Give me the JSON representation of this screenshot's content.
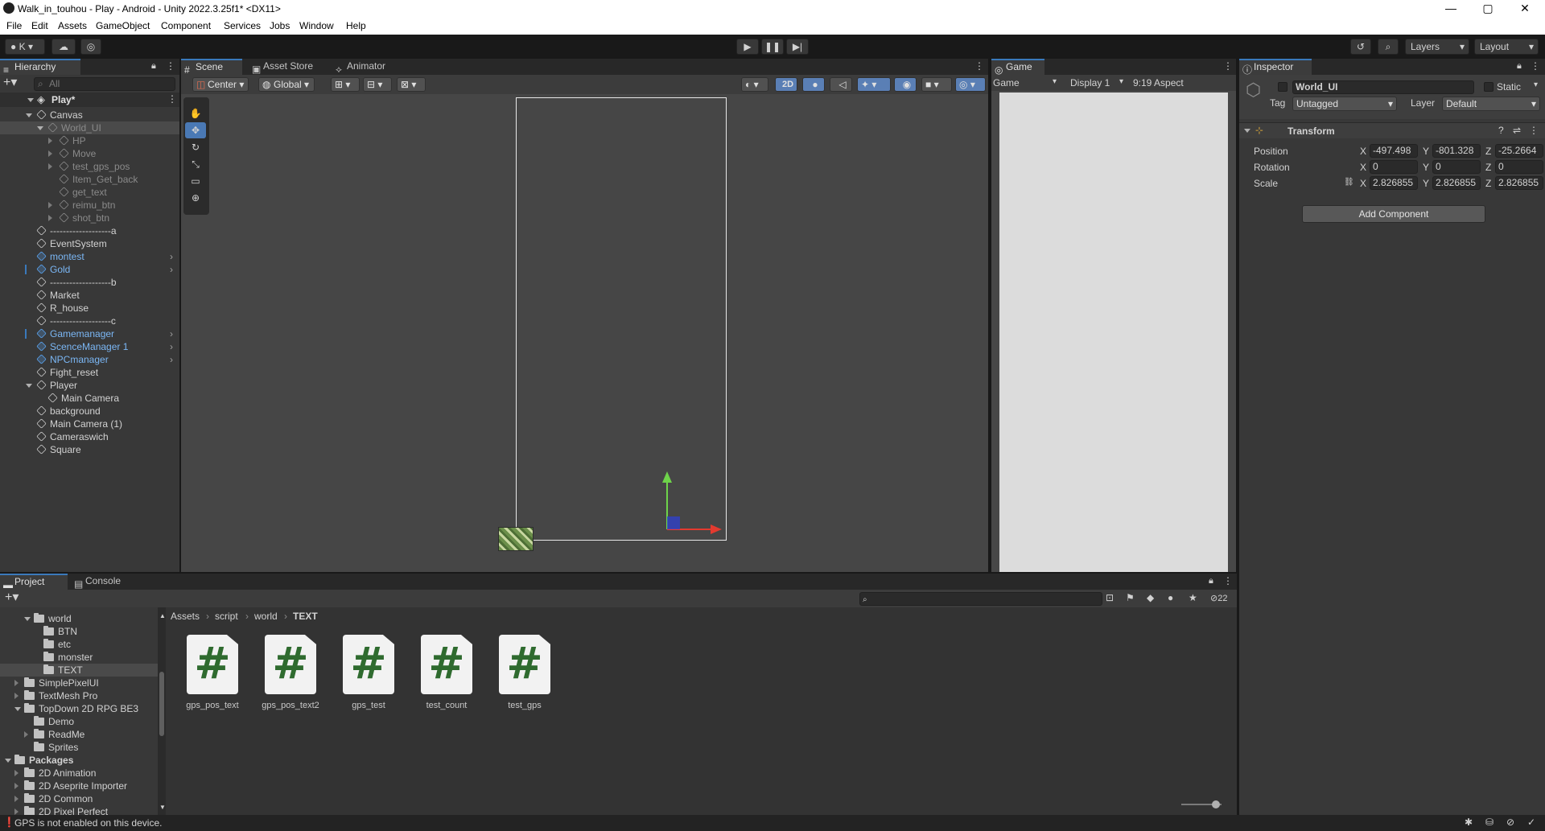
{
  "window": {
    "title": "Walk_in_touhou - Play - Android - Unity 2022.3.25f1* <DX11>",
    "controls": [
      "—",
      "▢",
      "✕"
    ]
  },
  "menu": [
    "File",
    "Edit",
    "Assets",
    "GameObject",
    "Component",
    "Services",
    "Jobs",
    "Window",
    "Help"
  ],
  "toolbar": {
    "account": "K",
    "layers": "Layers",
    "layout": "Layout"
  },
  "hierarchy": {
    "tab": "Hierarchy",
    "search_placeholder": "All",
    "scene": "Play*",
    "items": [
      {
        "label": "Canvas",
        "indent": 1,
        "arrow": "down",
        "style": "normal"
      },
      {
        "label": "World_UI",
        "indent": 2,
        "arrow": "down",
        "style": "dim"
      },
      {
        "label": "HP",
        "indent": 3,
        "arrow": "right",
        "style": "dim"
      },
      {
        "label": "Move",
        "indent": 3,
        "arrow": "right",
        "style": "dim"
      },
      {
        "label": "test_gps_pos",
        "indent": 3,
        "arrow": "right",
        "style": "dim"
      },
      {
        "label": "Item_Get_back",
        "indent": 3,
        "arrow": "",
        "style": "dim"
      },
      {
        "label": "get_text",
        "indent": 3,
        "arrow": "",
        "style": "dim"
      },
      {
        "label": "reimu_btn",
        "indent": 3,
        "arrow": "right",
        "style": "dim"
      },
      {
        "label": "shot_btn",
        "indent": 3,
        "arrow": "right",
        "style": "dim"
      },
      {
        "label": "-------------------a",
        "indent": 1,
        "arrow": "",
        "style": "normal"
      },
      {
        "label": "EventSystem",
        "indent": 1,
        "arrow": "",
        "style": "normal"
      },
      {
        "label": "montest",
        "indent": 1,
        "arrow": "",
        "style": "blue",
        "chevron": true
      },
      {
        "label": "Gold",
        "indent": 1,
        "arrow": "",
        "style": "blue",
        "chevron": true
      },
      {
        "label": "-------------------b",
        "indent": 1,
        "arrow": "",
        "style": "normal"
      },
      {
        "label": "Market",
        "indent": 1,
        "arrow": "",
        "style": "normal"
      },
      {
        "label": "R_house",
        "indent": 1,
        "arrow": "",
        "style": "normal"
      },
      {
        "label": "-------------------c",
        "indent": 1,
        "arrow": "",
        "style": "normal"
      },
      {
        "label": "Gamemanager",
        "indent": 1,
        "arrow": "",
        "style": "blue",
        "chevron": true
      },
      {
        "label": "ScenceManager 1",
        "indent": 1,
        "arrow": "",
        "style": "blue",
        "chevron": true
      },
      {
        "label": "NPCmanager",
        "indent": 1,
        "arrow": "",
        "style": "blue",
        "chevron": true
      },
      {
        "label": "Fight_reset",
        "indent": 1,
        "arrow": "",
        "style": "normal"
      },
      {
        "label": "Player",
        "indent": 1,
        "arrow": "down",
        "style": "normal"
      },
      {
        "label": "Main Camera",
        "indent": 2,
        "arrow": "",
        "style": "normal"
      },
      {
        "label": "background",
        "indent": 1,
        "arrow": "",
        "style": "normal"
      },
      {
        "label": "Main Camera (1)",
        "indent": 1,
        "arrow": "",
        "style": "normal"
      },
      {
        "label": "Cameraswich",
        "indent": 1,
        "arrow": "",
        "style": "normal"
      },
      {
        "label": "Square",
        "indent": 1,
        "arrow": "",
        "style": "normal"
      }
    ]
  },
  "scene_tabs": [
    "Scene",
    "Asset Store",
    "Animator"
  ],
  "scene_toolbar": {
    "pivot": "Center",
    "space": "Global",
    "mode_2d": "2D"
  },
  "game": {
    "tab": "Game",
    "view": "Game",
    "display": "Display 1",
    "aspect": "9:19 Aspect"
  },
  "inspector": {
    "tab": "Inspector",
    "object_name": "World_UI",
    "static_label": "Static",
    "tag_label": "Tag",
    "tag_value": "Untagged",
    "layer_label": "Layer",
    "layer_value": "Default",
    "component": "Transform",
    "rows": [
      {
        "label": "Position",
        "x": "-497.498",
        "y": "-801.328",
        "z": "-25.2664"
      },
      {
        "label": "Rotation",
        "x": "0",
        "y": "0",
        "z": "0"
      },
      {
        "label": "Scale",
        "x": "2.826855",
        "y": "2.826855",
        "z": "2.826855"
      }
    ],
    "add_component": "Add Component"
  },
  "project": {
    "tabs": [
      "Project",
      "Console"
    ],
    "hidden_count": "22",
    "tree": [
      {
        "label": "world",
        "indent": 2,
        "arrow": "down",
        "bold": false
      },
      {
        "label": "BTN",
        "indent": 3,
        "arrow": "",
        "bold": false
      },
      {
        "label": "etc",
        "indent": 3,
        "arrow": "",
        "bold": false
      },
      {
        "label": "monster",
        "indent": 3,
        "arrow": "",
        "bold": false
      },
      {
        "label": "TEXT",
        "indent": 3,
        "arrow": "",
        "bold": false,
        "selected": true
      },
      {
        "label": "SimplePixelUI",
        "indent": 1,
        "arrow": "right",
        "bold": false
      },
      {
        "label": "TextMesh Pro",
        "indent": 1,
        "arrow": "right",
        "bold": false
      },
      {
        "label": "TopDown 2D RPG BE3",
        "indent": 1,
        "arrow": "down",
        "bold": false
      },
      {
        "label": "Demo",
        "indent": 2,
        "arrow": "",
        "bold": false
      },
      {
        "label": "ReadMe",
        "indent": 2,
        "arrow": "right",
        "bold": false
      },
      {
        "label": "Sprites",
        "indent": 2,
        "arrow": "",
        "bold": false
      },
      {
        "label": "Packages",
        "indent": 0,
        "arrow": "down",
        "bold": true
      },
      {
        "label": "2D Animation",
        "indent": 1,
        "arrow": "right",
        "bold": false
      },
      {
        "label": "2D Aseprite Importer",
        "indent": 1,
        "arrow": "right",
        "bold": false
      },
      {
        "label": "2D Common",
        "indent": 1,
        "arrow": "right",
        "bold": false
      },
      {
        "label": "2D Pixel Perfect",
        "indent": 1,
        "arrow": "right",
        "bold": false
      }
    ],
    "breadcrumb": [
      "Assets",
      "script",
      "world",
      "TEXT"
    ],
    "files": [
      "gps_pos_text",
      "gps_pos_text2",
      "gps_test",
      "test_count",
      "test_gps"
    ]
  },
  "status": {
    "message": "GPS is not enabled on this device."
  },
  "colors": {
    "accent": "#3a79bb",
    "prefab_blue": "#7bb7f5",
    "script_green": "#2f6b2f"
  }
}
